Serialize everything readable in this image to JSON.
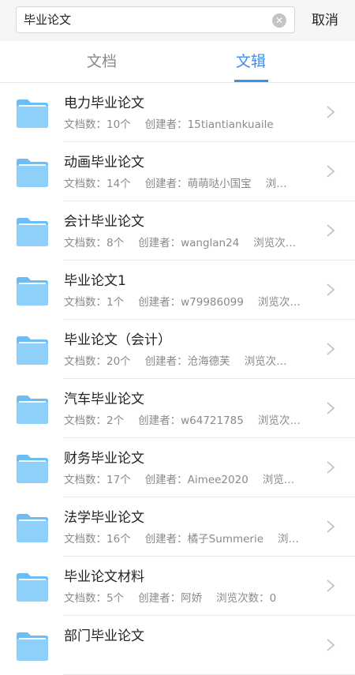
{
  "search": {
    "value": "毕业论文",
    "clear_icon": "clear-icon",
    "cancel_label": "取消"
  },
  "tabs": [
    {
      "label": "文档",
      "active": false
    },
    {
      "label": "文辑",
      "active": true
    }
  ],
  "colors": {
    "accent": "#3b8ff0",
    "folder": "#7cc7f8"
  },
  "items": [
    {
      "title": "电力毕业论文",
      "count": "文档数：10个",
      "creator": "创建者：15tiantiankuaile",
      "views": ""
    },
    {
      "title": "动画毕业论文",
      "count": "文档数：14个",
      "creator": "创建者：萌萌哒小国宝",
      "views": "浏…"
    },
    {
      "title": "会计毕业论文",
      "count": "文档数：8个",
      "creator": "创建者：wanglan24",
      "views": "浏览次…"
    },
    {
      "title": "毕业论文1",
      "count": "文档数：1个",
      "creator": "创建者：w79986099",
      "views": "浏览次…"
    },
    {
      "title": "毕业论文（会计）",
      "count": "文档数：20个",
      "creator": "创建者：沧海德芙",
      "views": "浏览次…"
    },
    {
      "title": "汽车毕业论文",
      "count": "文档数：2个",
      "creator": "创建者：w64721785",
      "views": "浏览次…"
    },
    {
      "title": "财务毕业论文",
      "count": "文档数：17个",
      "creator": "创建者：Aimee2020",
      "views": "浏览…"
    },
    {
      "title": "法学毕业论文",
      "count": "文档数：16个",
      "creator": "创建者：橘子Summerie",
      "views": "浏…"
    },
    {
      "title": "毕业论文材料",
      "count": "文档数：5个",
      "creator": "创建者：阿娇",
      "views": "浏览次数：0"
    },
    {
      "title": "部门毕业论文",
      "count": "",
      "creator": "",
      "views": ""
    }
  ]
}
